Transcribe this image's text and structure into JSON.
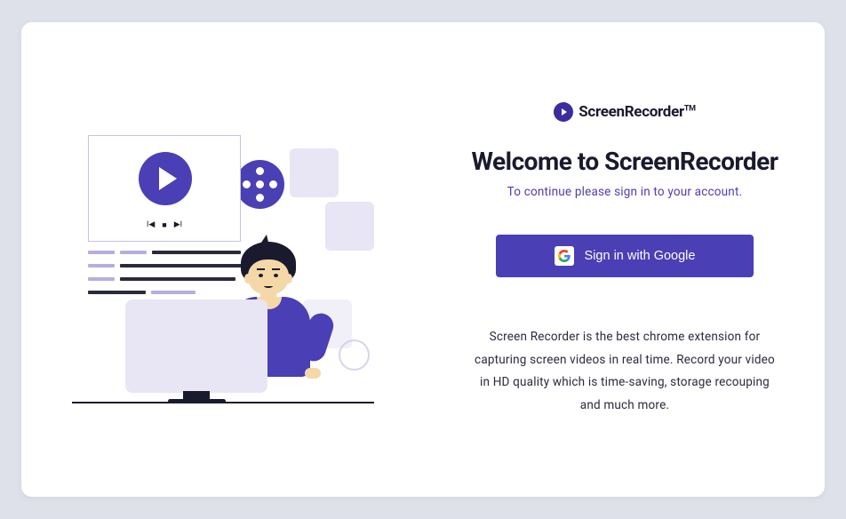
{
  "logo": {
    "name": "ScreenRecorder",
    "tm": "TM"
  },
  "welcome": {
    "title": "Welcome to ScreenRecorder",
    "subtitle": "To continue please sign in to your account."
  },
  "button": {
    "google_label": "Sign in with Google"
  },
  "description": "Screen Recorder is the best chrome extension for capturing screen videos in real time. Record your video in HD quality which is time-saving, storage recouping and much more."
}
